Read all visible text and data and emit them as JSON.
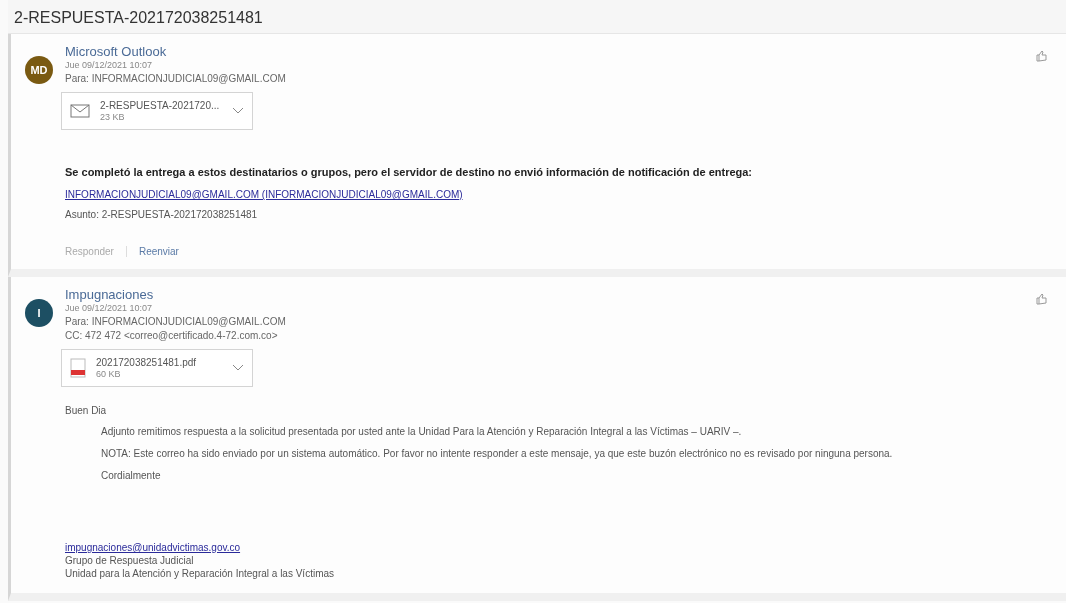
{
  "subject": "2-RESPUESTA-202172038251481",
  "messages": [
    {
      "avatar": {
        "initials": "MD",
        "color": "#7a5a12"
      },
      "sender": "Microsoft Outlook",
      "date": "Jue 09/12/2021 10:07",
      "to": "Para: INFORMACIONJUDICIAL09@GMAIL.COM",
      "attachment": {
        "kind": "mail",
        "name": "2-RESPUESTA-2021720...",
        "size": "23 KB"
      },
      "body": [
        {
          "kind": "bold",
          "text": "Se completó la entrega a estos destinatarios o grupos, pero el servidor de destino no envió información de notificación de entrega:"
        },
        {
          "kind": "link",
          "text": "INFORMACIONJUDICIAL09@GMAIL.COM (INFORMACIONJUDICIAL09@GMAIL.COM)"
        },
        {
          "kind": "small",
          "text": "Asunto: 2-RESPUESTA-202172038251481"
        }
      ],
      "actions": [
        {
          "label": "Responder",
          "disabled": true
        },
        {
          "label": "Reenviar",
          "disabled": false
        }
      ]
    },
    {
      "avatar": {
        "initials": "I",
        "color": "#1d4f63"
      },
      "sender": "Impugnaciones",
      "date": "Jue 09/12/2021 10:07",
      "to": "Para: INFORMACIONJUDICIAL09@GMAIL.COM",
      "cc": "CC: 472 472 <correo@certificado.4-72.com.co>",
      "attachment": {
        "kind": "pdf",
        "name": "202172038251481.pdf",
        "size": "60 KB"
      },
      "body": [
        {
          "kind": "plain",
          "text": "Buen Dia"
        },
        {
          "kind": "indent",
          "text": "Adjunto remitimos respuesta a la solicitud presentada por usted ante la Unidad Para la Atención y Reparación Integral a las Víctimas – UARIV –."
        },
        {
          "kind": "indent",
          "text": "NOTA: Este correo ha sido enviado por un sistema automático. Por favor no intente responder a este mensaje, ya que este buzón electrónico no es revisado por ninguna persona."
        },
        {
          "kind": "indent",
          "text": "Cordialmente"
        },
        {
          "kind": "sig-link",
          "text": "impugnaciones@unidadvictimas.gov.co"
        },
        {
          "kind": "sig",
          "text": "Grupo de Respuesta Judicial"
        },
        {
          "kind": "sig",
          "text": "Unidad para la Atención y Reparación Integral a las Víctimas"
        }
      ]
    }
  ]
}
